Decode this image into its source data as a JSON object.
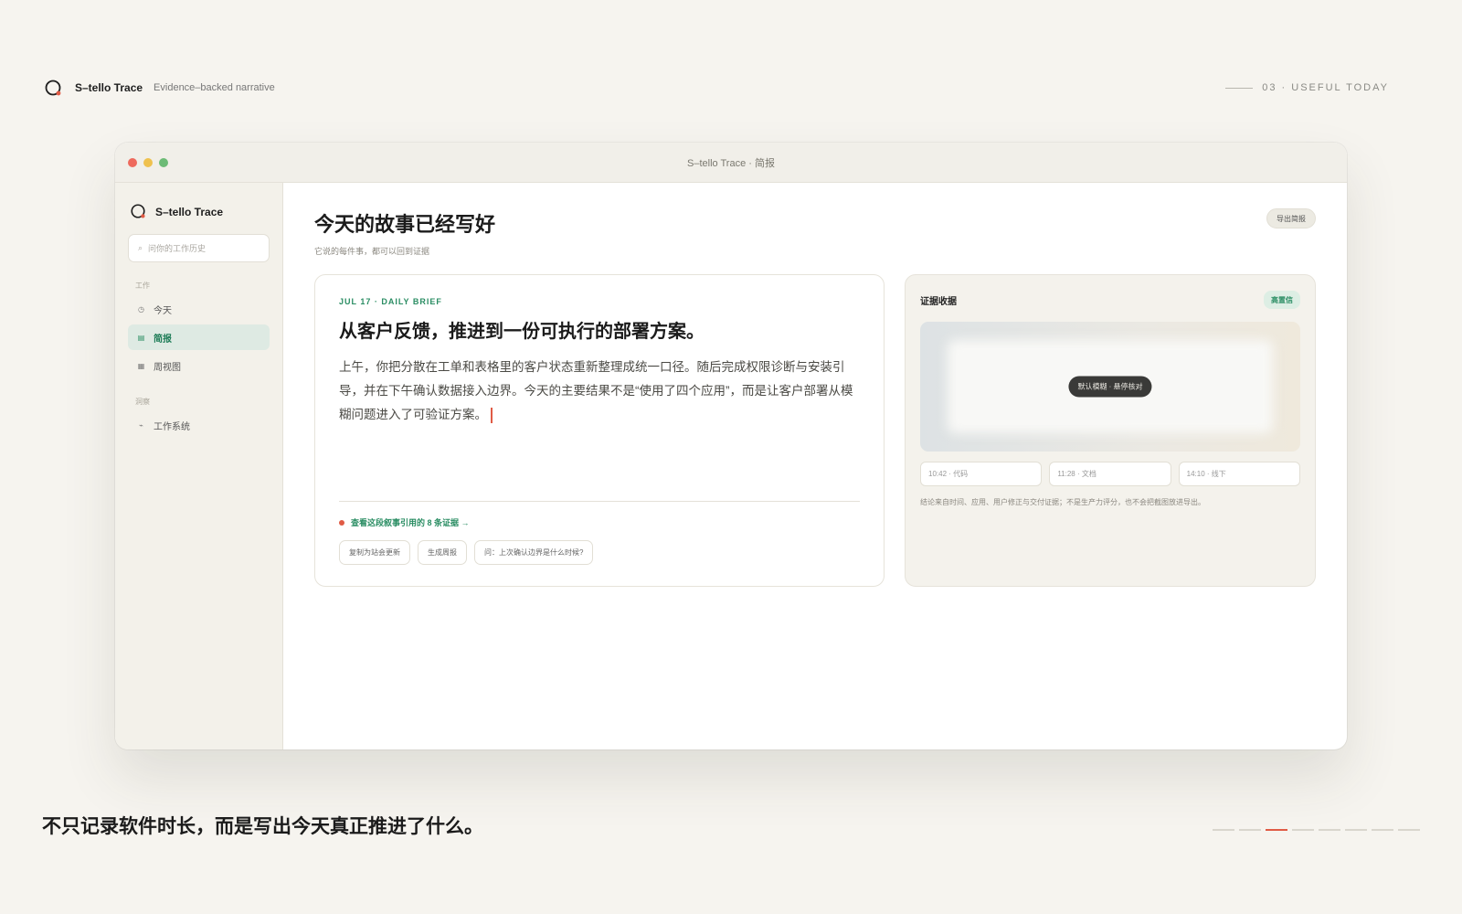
{
  "brand": {
    "name": "S–tello Trace",
    "tagline": "Evidence–backed narrative"
  },
  "section": {
    "label": "03 · USEFUL TODAY"
  },
  "window": {
    "title": "S–tello Trace · 简报"
  },
  "sidebar": {
    "brand": "S–tello Trace",
    "search_placeholder": "问你的工作历史",
    "group_work": "工作",
    "items": [
      {
        "label": "今天",
        "icon": "clock-icon"
      },
      {
        "label": "简报",
        "icon": "document-icon",
        "active": true
      },
      {
        "label": "周视图",
        "icon": "calendar-icon"
      }
    ],
    "group_insight": "洞察",
    "insight_items": [
      {
        "label": "工作系统",
        "icon": "flow-icon"
      }
    ]
  },
  "main": {
    "title": "今天的故事已经写好",
    "subtitle": "它说的每件事，都可以回到证据",
    "export_label": "导出简报"
  },
  "brief": {
    "kicker": "JUL 17 · DAILY BRIEF",
    "headline": "从客户反馈，推进到一份可执行的部署方案。",
    "body": "上午，你把分散在工单和表格里的客户状态重新整理成统一口径。随后完成权限诊断与安装引导，并在下午确认数据接入边界。今天的主要结果不是“使用了四个应用”，而是让客户部署从模糊问题进入了可验证方案。",
    "evidence_link": "查看这段叙事引用的 8 条证据 →",
    "actions": [
      "复制为站会更新",
      "生成周报",
      "问：上次确认边界是什么时候?"
    ]
  },
  "evidence": {
    "title": "证据收据",
    "badge": "高置信",
    "preview_pill": "默认模糊 · 悬停核对",
    "slots": [
      "10:42 · 代码",
      "11:28 · 文档",
      "14:10 · 线下"
    ],
    "note": "结论来自时间、应用、用户修正与交付证据；不是生产力评分，也不会把截图放进导出。"
  },
  "caption": "不只记录软件时长，而是写出今天真正推进了什么。",
  "pager": {
    "total": 8,
    "current": 3
  },
  "colors": {
    "accent": "#2a8d63",
    "highlight": "#e05b45",
    "background": "#f6f4ef"
  }
}
